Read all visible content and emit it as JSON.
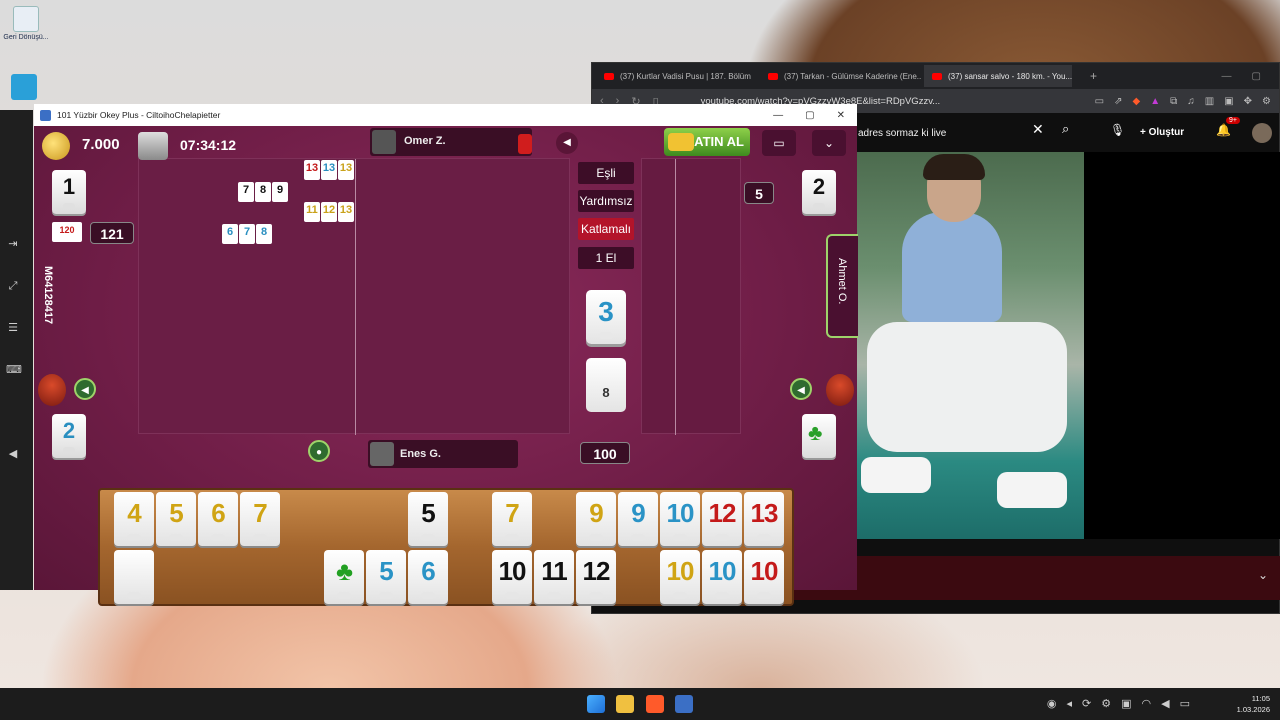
{
  "desktop": {
    "recycle_bin_label": "Geri Dönüşü..."
  },
  "browser": {
    "tabs": [
      {
        "title": "(37) Kurtlar Vadisi Pusu | 187. Bölüm"
      },
      {
        "title": "(37) Tarkan - Gülümse Kaderine (Ene..."
      },
      {
        "title": "(37) sansar salvo - 180 km. - You..."
      }
    ],
    "url": "youtube.com/watch?v=pVGzzvW3e8E&list=RDpVGzzv...",
    "search_text": "adres sormaz ki live",
    "create_label": "Oluştur",
    "notif_badge": "9+"
  },
  "game": {
    "window_title": "101 Yüzbir Okey Plus - CiltoihoChelapietter",
    "chips": "7.000",
    "timer": "07:34:12",
    "top_player": "Omer Z.",
    "bottom_player": "Enes G.",
    "right_player": "Ahmet O.",
    "left_player_id": "M64128417",
    "buy_label": "SATIN AL",
    "rules": [
      "Eşli",
      "Yardımsız",
      "Katlamalı",
      "1 El"
    ],
    "seat_left_top": "1",
    "seat_right_top": "2",
    "seat_left_bottom": "2",
    "left_score": "121",
    "right_score": "5",
    "mini_score": "120",
    "indicator_tile": "3",
    "remaining_tiles": "8",
    "hand_points": "100",
    "melds": [
      {
        "tiles": [
          "7",
          "8",
          "9"
        ],
        "color": "black"
      },
      {
        "tiles": [
          "6",
          "7",
          "8"
        ],
        "color": "blue"
      },
      {
        "tiles": [
          "13",
          "13",
          "13"
        ],
        "colors": [
          "red",
          "blue",
          "yellow"
        ]
      },
      {
        "tiles": [
          "11",
          "12",
          "13"
        ],
        "color": "yellow"
      }
    ],
    "rack_top": [
      {
        "v": "4",
        "c": "yellow"
      },
      {
        "v": "5",
        "c": "yellow"
      },
      {
        "v": "6",
        "c": "yellow"
      },
      {
        "v": "7",
        "c": "yellow"
      },
      {
        "v": "5",
        "c": "black"
      },
      {
        "v": "7",
        "c": "yellow"
      },
      {
        "v": "9",
        "c": "yellow"
      },
      {
        "v": "9",
        "c": "blue"
      },
      {
        "v": "10",
        "c": "blue"
      },
      {
        "v": "12",
        "c": "red"
      },
      {
        "v": "13",
        "c": "red"
      }
    ],
    "rack_bottom": [
      {
        "v": "",
        "c": "black"
      },
      {
        "v": "♣",
        "c": "green"
      },
      {
        "v": "5",
        "c": "blue"
      },
      {
        "v": "6",
        "c": "blue"
      },
      {
        "v": "10",
        "c": "black"
      },
      {
        "v": "11",
        "c": "black"
      },
      {
        "v": "12",
        "c": "black"
      },
      {
        "v": "10",
        "c": "yellow"
      },
      {
        "v": "10",
        "c": "blue"
      },
      {
        "v": "10",
        "c": "red"
      }
    ]
  },
  "taskbar": {
    "time": "11:05",
    "date": "1.03.2026"
  }
}
